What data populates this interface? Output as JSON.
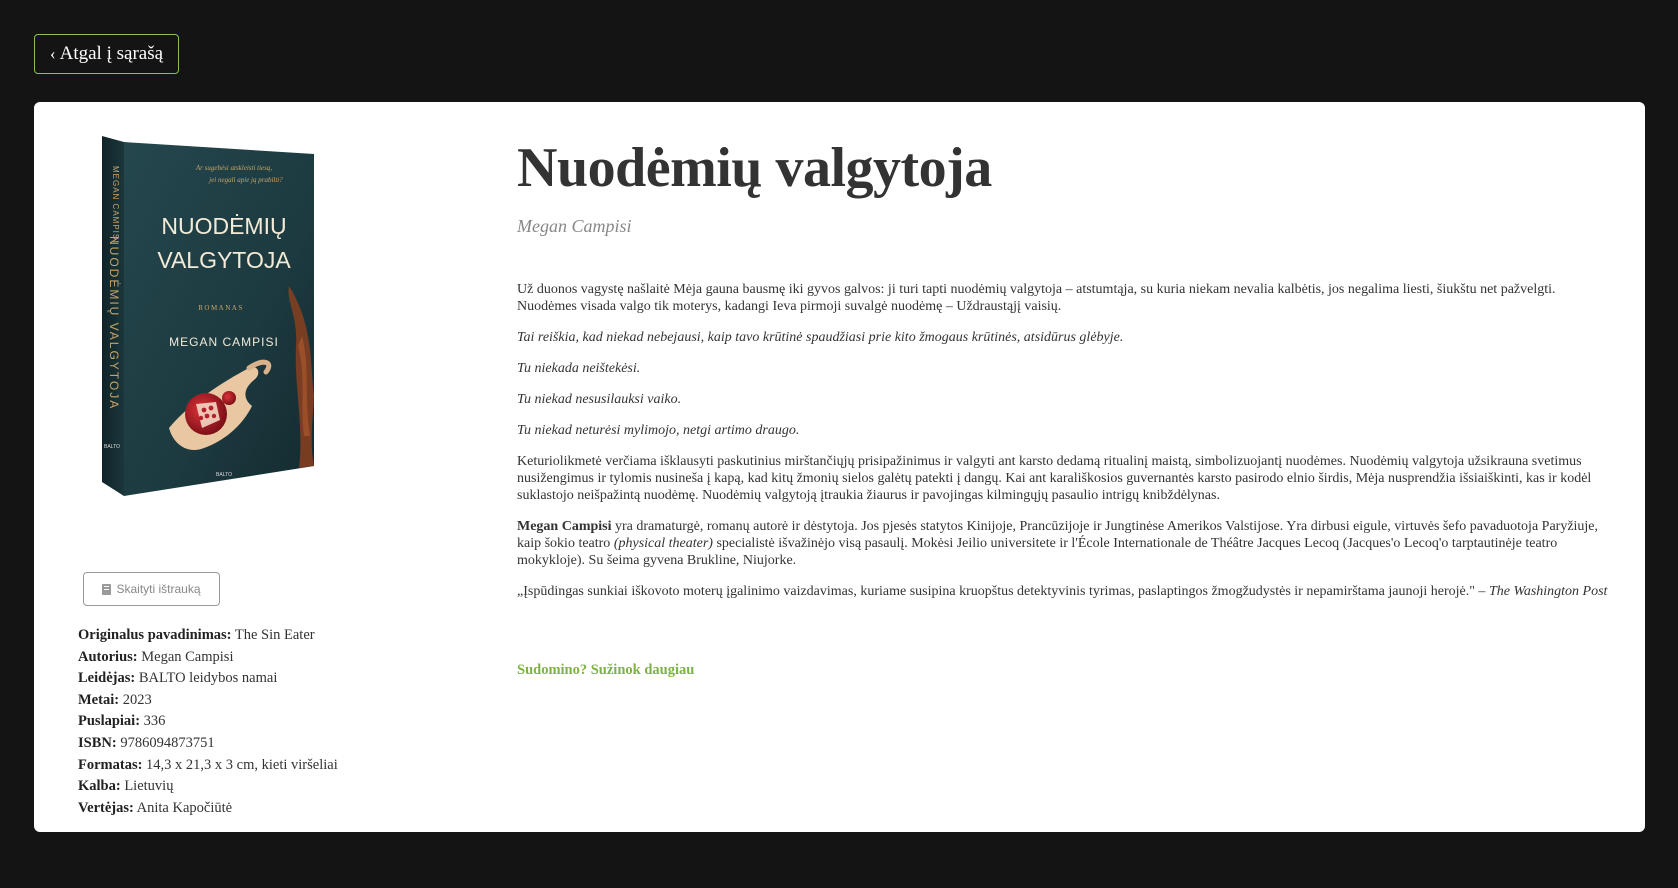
{
  "nav": {
    "back_label": "Atgal į sąrašą"
  },
  "book": {
    "title": "Nuodėmių valgytoja",
    "author": "Megan Campisi",
    "cover": {
      "tagline_1": "Ar sugebėsi atskleisti tiesą,",
      "tagline_2": "jei negali apie ją prabilti?",
      "title_line_1": "NUODĖMIŲ",
      "title_line_2": "VALGYTOJA",
      "genre": "ROMANAS",
      "author": "MEGAN CAMPISI",
      "spine_author": "MEGAN CAMPISI",
      "spine_title": "NUODĖMIŲ VALGYTOJA",
      "publisher": "BALTO",
      "colors": {
        "cover": "#1f3f45",
        "accent": "#c9a46a",
        "pomegranate": "#b3202a"
      }
    },
    "excerpt_button": "Skaityti ištrauką",
    "details": [
      {
        "label": "Originalus pavadinimas:",
        "value": "The Sin Eater"
      },
      {
        "label": "Autorius:",
        "value": "Megan Campisi"
      },
      {
        "label": "Leidėjas:",
        "value": "BALTO leidybos namai"
      },
      {
        "label": "Metai:",
        "value": "2023"
      },
      {
        "label": "Puslapiai:",
        "value": "336"
      },
      {
        "label": "ISBN:",
        "value": "9786094873751"
      },
      {
        "label": "Formatas:",
        "value": "14,3 x 21,3 x 3 cm, kieti viršeliai"
      },
      {
        "label": "Kalba:",
        "value": "Lietuvių"
      },
      {
        "label": "Vertėjas:",
        "value": "Anita Kapočiūtė"
      }
    ],
    "description": {
      "p1": "Už duonos vagystę našlaitė Mėja gauna bausmę iki gyvos galvos: ji turi tapti nuodėmių valgytoja – atstumtąja, su kuria niekam nevalia kalbėtis, jos negalima liesti, šiukštu net pažvelgti. Nuodėmes visada valgo tik moterys, kadangi Ieva pirmoji suvalgė nuodėmę – Uždraustąjį vaisių.",
      "p2": "Tai reiškia, kad niekad nebejausi, kaip tavo krūtinė spaudžiasi prie kito žmogaus krūtinės, atsidūrus glėbyje.",
      "p3": "Tu niekada neištekėsi.",
      "p4": "Tu niekad nesusilauksi vaiko.",
      "p5": "Tu niekad neturėsi mylimojo, netgi artimo draugo.",
      "p6": "Keturiolikmetė verčiama išklausyti paskutinius mirštančiųjų prisipažinimus ir valgyti ant karsto dedamą ritualinį maistą, simbolizuojantį nuodėmes. Nuodėmių valgytoja užsikrauna svetimus nusižengimus ir tylomis nusineša į kapą, kad kitų žmonių sielos galėtų patekti į dangų. Kai ant karališkosios guvernantės karsto pasirodo elnio širdis, Mėja nusprendžia išsiaiškinti, kas ir kodėl suklastojo neišpažintą nuodėmę. Nuodėmių valgytoją įtraukia žiaurus ir pavojingas kilmingųjų pasaulio intrigų knibždėlynas.",
      "p7_name": "Megan Campisi",
      "p7_a": " yra dramaturgė, romanų autorė ir dėstytoja. Jos pjesės statytos Kinijoje, Prancūzijoje ir Jungtinėse Amerikos Valstijose. Yra dirbusi eigule, virtuvės šefo pavaduotoja Paryžiuje, kaip šokio teatro ",
      "p7_italic": "(physical theater)",
      "p7_b": " specialistė išvažinėjo visą pasaulį. Mokėsi Jeilio universitete ir l'École Internationale de Théâtre Jacques Lecoq (Jacques'o Lecoq'o tarptautinėje teatro mokykloje). Su šeima gyvena Brukline, Niujorke.",
      "p8_quote": "„Įspūdingas sunkiai iškovoto moterų įgalinimo vaizdavimas, kuriame susipina kruopštus detektyvinis tyrimas, paslaptingos žmogžudystės ir nepamirštama jaunoji herojė.\" – ",
      "p8_source": "The Washington Post"
    },
    "more_link": "Sudomino? Sužinok daugiau"
  },
  "theme": {
    "background": "#141414",
    "card": "#ffffff",
    "accent": "#8bc34a",
    "link": "#7cb342"
  }
}
